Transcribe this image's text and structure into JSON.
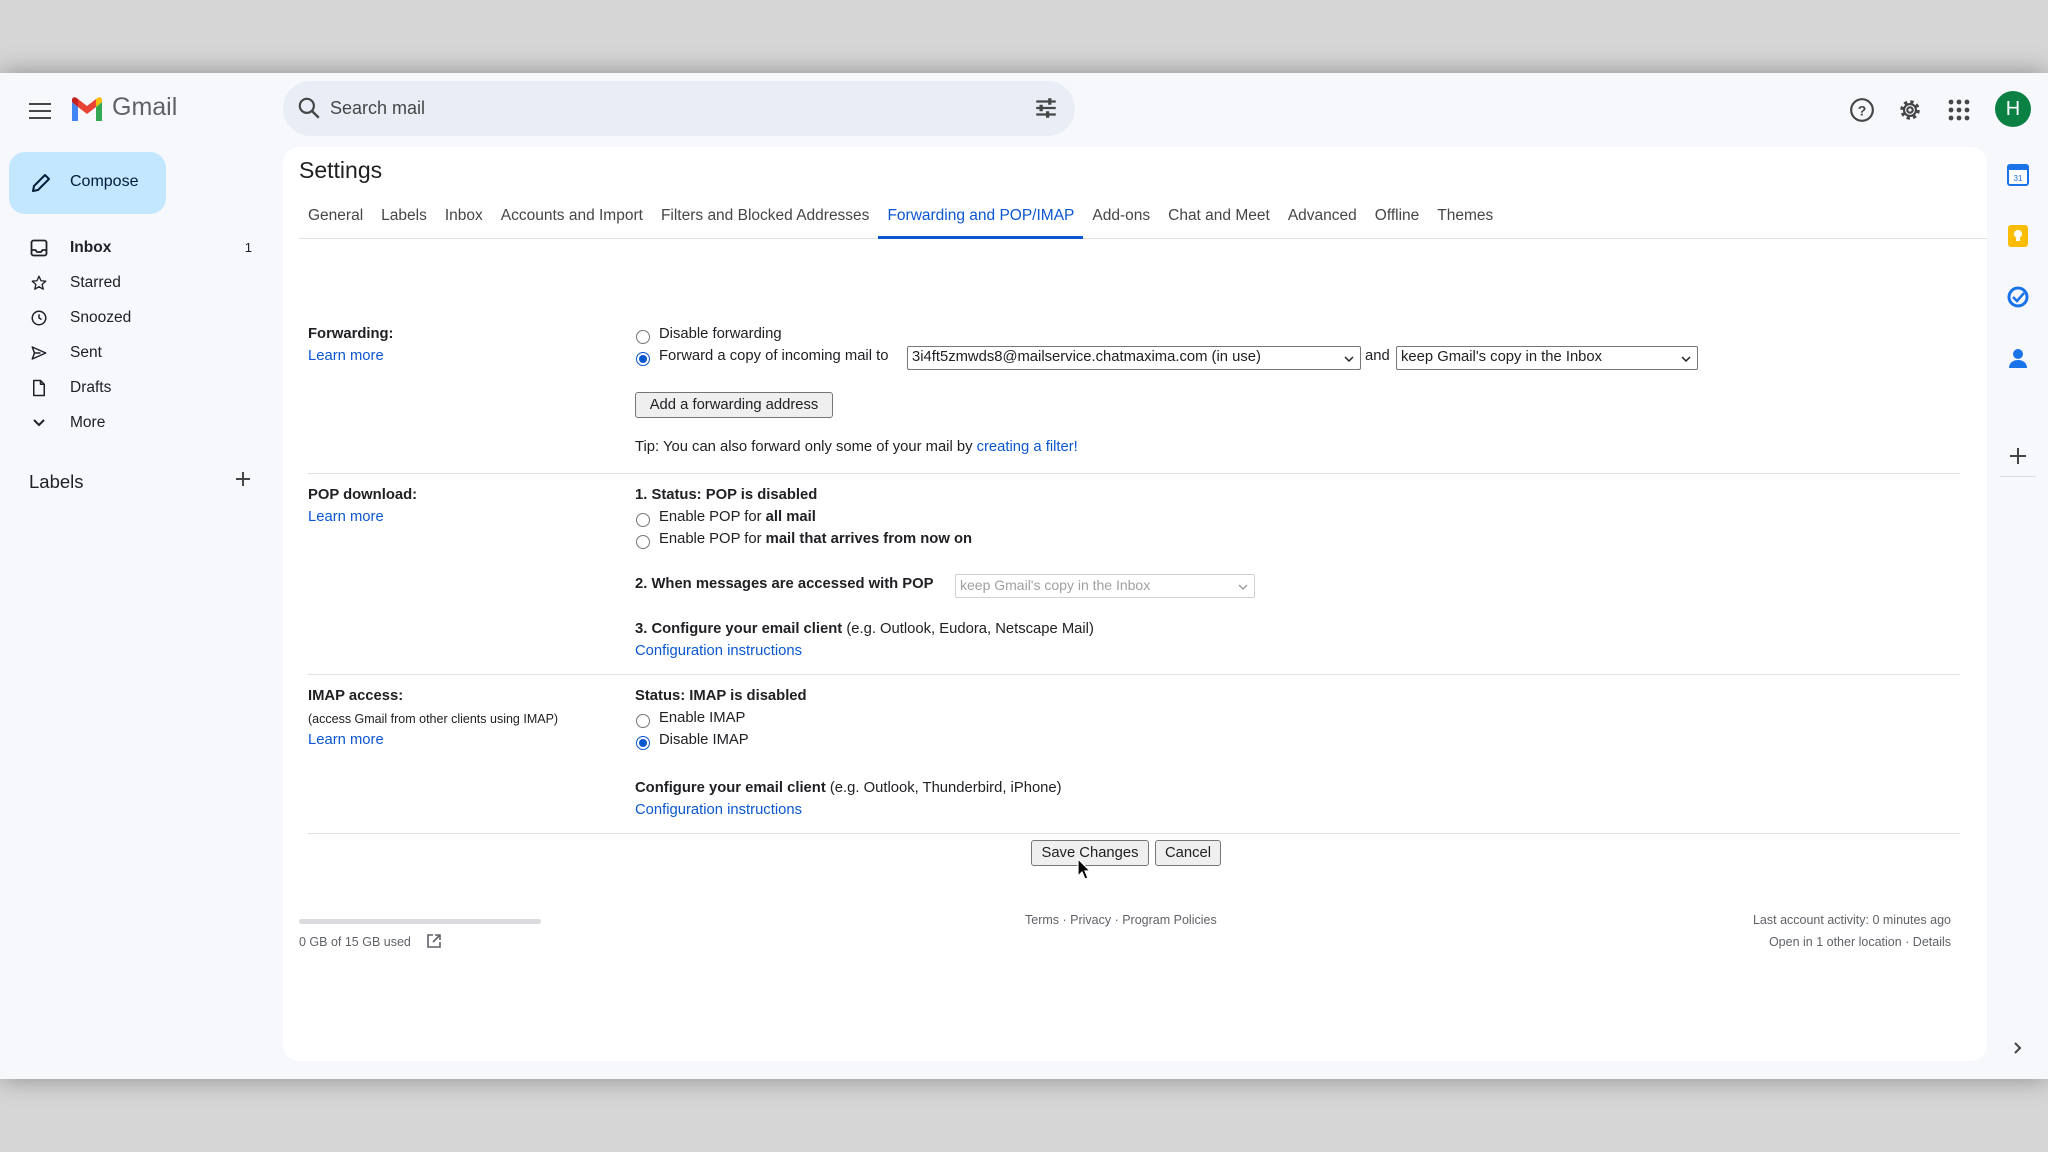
{
  "app": {
    "name": "Gmail",
    "avatar_letter": "H"
  },
  "search": {
    "placeholder": "Search mail"
  },
  "header_icons": [
    "help-icon",
    "gear-icon",
    "apps-grid-icon"
  ],
  "sidebar": {
    "compose_label": "Compose",
    "items": [
      {
        "label": "Inbox",
        "count": "1",
        "icon": "inbox-icon"
      },
      {
        "label": "Starred",
        "count": "",
        "icon": "star-icon"
      },
      {
        "label": "Snoozed",
        "count": "",
        "icon": "clock-icon"
      },
      {
        "label": "Sent",
        "count": "",
        "icon": "send-icon"
      },
      {
        "label": "Drafts",
        "count": "",
        "icon": "draft-icon"
      },
      {
        "label": "More",
        "count": "",
        "icon": "chevron-down-icon"
      }
    ],
    "labels_title": "Labels"
  },
  "settings": {
    "title": "Settings",
    "tabs": [
      "General",
      "Labels",
      "Inbox",
      "Accounts and Import",
      "Filters and Blocked Addresses",
      "Forwarding and POP/IMAP",
      "Add-ons",
      "Chat and Meet",
      "Advanced",
      "Offline",
      "Themes"
    ],
    "active_tab": "Forwarding and POP/IMAP",
    "forwarding": {
      "label": "Forwarding:",
      "learn_more": "Learn more",
      "disable_option": "Disable forwarding",
      "forward_option": "Forward a copy of incoming mail to",
      "forward_address": "3i4ft5zmwds8@mailservice.chatmaxima.com (in use)",
      "and_text": "and",
      "copy_action": "keep Gmail's copy in the Inbox",
      "add_button": "Add a forwarding address",
      "tip_text": "Tip: You can also forward only some of your mail by",
      "tip_link": "creating a filter!"
    },
    "pop": {
      "label": "POP download:",
      "learn_more": "Learn more",
      "status": "1. Status: POP is disabled",
      "option_all_prefix": "Enable POP for",
      "option_all_bold": "all mail",
      "option_now_prefix": "Enable POP for",
      "option_now_bold": "mail that arrives from now on",
      "when_accessed": "2. When messages are accessed with POP",
      "when_accessed_value": "keep Gmail's copy in the Inbox",
      "configure_bold": "3. Configure your email client",
      "configure_rest": "(e.g. Outlook, Eudora, Netscape Mail)",
      "config_link": "Configuration instructions"
    },
    "imap": {
      "label": "IMAP access:",
      "sublabel": "(access Gmail from other clients using IMAP)",
      "learn_more": "Learn more",
      "status": "Status: IMAP is disabled",
      "enable_option": "Enable IMAP",
      "disable_option": "Disable IMAP",
      "configure_bold": "Configure your email client",
      "configure_rest": "(e.g. Outlook, Thunderbird, iPhone)",
      "config_link": "Configuration instructions"
    },
    "save_button": "Save Changes",
    "cancel_button": "Cancel"
  },
  "footer": {
    "storage": "0 GB of 15 GB used",
    "storage_fraction": 0,
    "links": "Terms · Privacy · Program Policies",
    "activity": "Last account activity: 0 minutes ago",
    "location": "Open in 1 other location · Details"
  },
  "side_panel_icons": [
    "calendar-icon",
    "keep-icon",
    "tasks-icon",
    "contacts-icon",
    "add-icon",
    "chevron-right-icon"
  ]
}
